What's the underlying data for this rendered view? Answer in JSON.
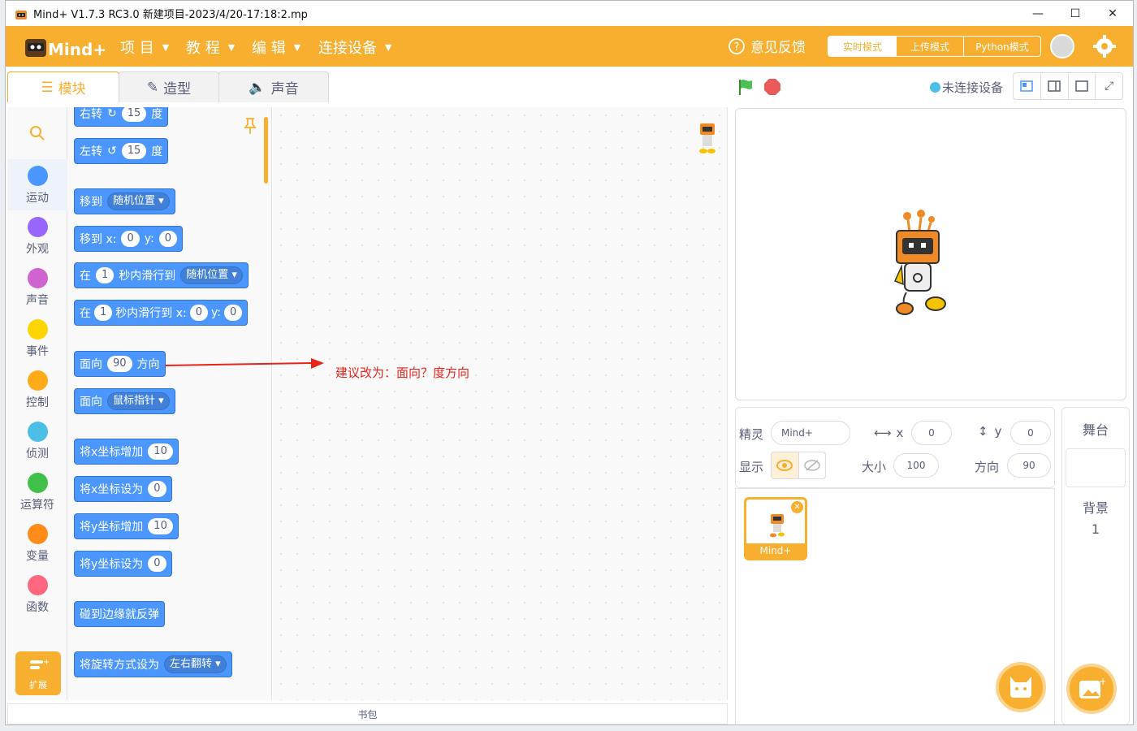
{
  "titlebar": {
    "title": "Mind+ V1.7.3 RC3.0    新建项目-2023/4/20-17:18:2.mp"
  },
  "menubar": {
    "items": [
      "项 目",
      "教 程",
      "编 辑",
      "连接设备"
    ],
    "feedback": "意见反馈",
    "modes": [
      "实时模式",
      "上传模式",
      "Python模式"
    ],
    "active_mode": "实时模式",
    "accent": "#f8ae2f"
  },
  "tabs": [
    "模块",
    "造型",
    "声音"
  ],
  "categories": [
    {
      "label": "运动",
      "color": "#4c97ff"
    },
    {
      "label": "外观",
      "color": "#9966ff"
    },
    {
      "label": "声音",
      "color": "#cf63cf"
    },
    {
      "label": "事件",
      "color": "#ffd500"
    },
    {
      "label": "控制",
      "color": "#ffab19"
    },
    {
      "label": "侦测",
      "color": "#4cbfe6"
    },
    {
      "label": "运算符",
      "color": "#40bf4a"
    },
    {
      "label": "变量",
      "color": "#ff8c1a"
    },
    {
      "label": "函数",
      "color": "#ff6680"
    }
  ],
  "extension_label": "扩展",
  "blocks": {
    "turn_right": {
      "t1": "右转",
      "n": "15",
      "t2": "度"
    },
    "turn_left": {
      "t1": "左转",
      "n": "15",
      "t2": "度"
    },
    "goto": {
      "t1": "移到",
      "d": "随机位置"
    },
    "goto_xy": {
      "t1": "移到 x:",
      "x": "0",
      "t2": "y:",
      "y": "0"
    },
    "glide": {
      "t1": "在",
      "n": "1",
      "t2": "秒内滑行到",
      "d": "随机位置"
    },
    "glide_xy": {
      "t1": "在",
      "n": "1",
      "t2": "秒内滑行到 x:",
      "x": "0",
      "t3": "y:",
      "y": "0"
    },
    "point_dir": {
      "t1": "面向",
      "n": "90",
      "t2": "方向"
    },
    "point_towards": {
      "t1": "面向",
      "d": "鼠标指针"
    },
    "change_x": {
      "t1": "将x坐标增加",
      "n": "10"
    },
    "set_x": {
      "t1": "将x坐标设为",
      "n": "0"
    },
    "change_y": {
      "t1": "将y坐标增加",
      "n": "10"
    },
    "set_y": {
      "t1": "将y坐标设为",
      "n": "0"
    },
    "bounce": {
      "t1": "碰到边缘就反弹"
    },
    "rotation": {
      "t1": "将旋转方式设为",
      "d": "左右翻转"
    }
  },
  "annotation": "建议改为：面向？度方向",
  "backpack": "书包",
  "stage_header": {
    "status": "未连接设备"
  },
  "sprite_info": {
    "sprite_label": "精灵",
    "sprite_name": "Mind+",
    "x_label": "x",
    "x": "0",
    "y_label": "y",
    "y": "0",
    "show_label": "显示",
    "size_label": "大小",
    "size": "100",
    "dir_label": "方向",
    "dir": "90"
  },
  "sprite_list": [
    {
      "name": "Mind+"
    }
  ],
  "stage_panel": {
    "title": "舞台",
    "backdrop_label": "背景",
    "backdrop_count": "1"
  }
}
